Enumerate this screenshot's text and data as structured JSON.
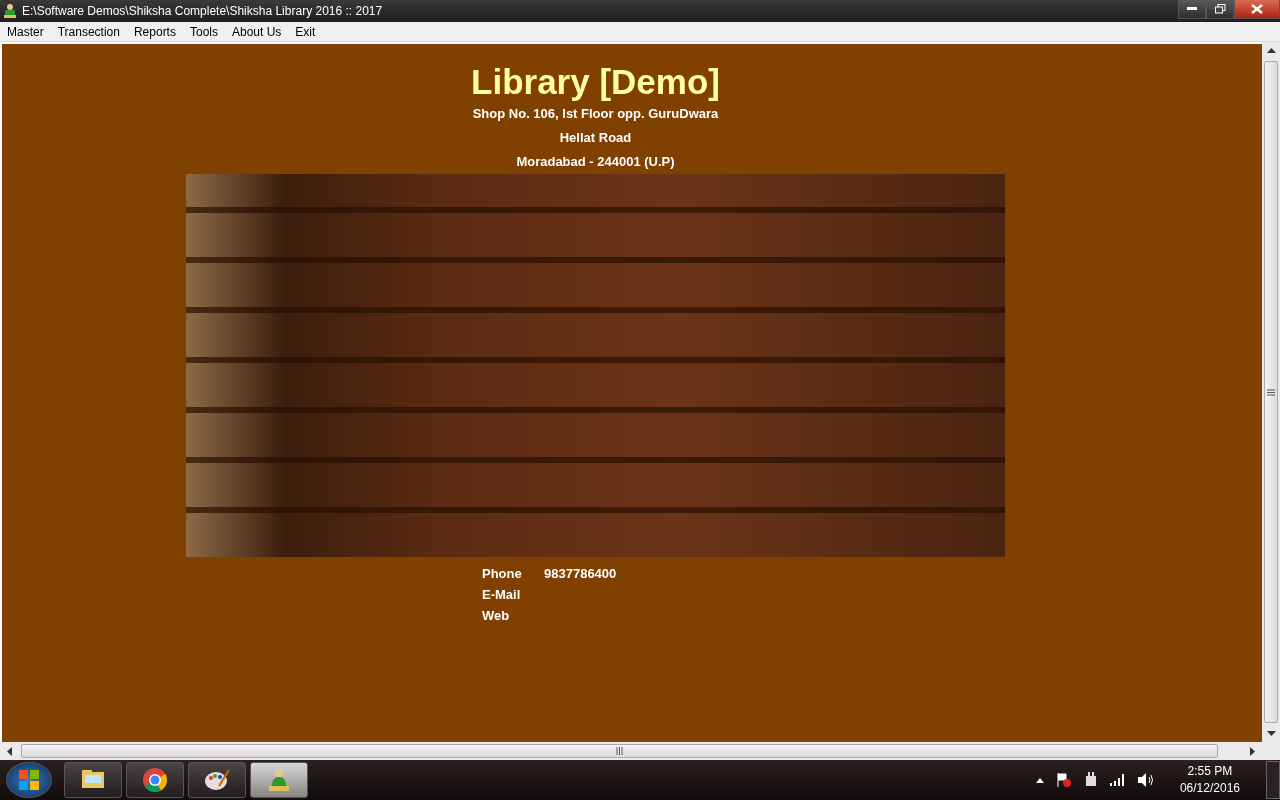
{
  "window": {
    "title": "E:\\Software Demos\\Shiksha Complete\\Shiksha Library 2016 :: 2017"
  },
  "menu": [
    "Master",
    "Transection",
    "Reports",
    "Tools",
    "About Us",
    "Exit"
  ],
  "header": {
    "title": "Library [Demo]",
    "address_lines": [
      "Shop No. 106, Ist Floor opp. GuruDwara",
      "Hellat Road",
      "Moradabad - 244001 (U.P)"
    ]
  },
  "contact": [
    {
      "label": "Phone",
      "value": "9837786400"
    },
    {
      "label": "E-Mail"
    },
    {
      "label": "Web"
    }
  ],
  "taskbar": {
    "apps": [
      {
        "kind": "folder",
        "selected": false
      },
      {
        "kind": "browser",
        "selected": false
      },
      {
        "kind": "paint",
        "selected": false
      },
      {
        "kind": "library",
        "selected": true
      }
    ],
    "time": "2:55 PM",
    "date": "06/12/2016"
  }
}
